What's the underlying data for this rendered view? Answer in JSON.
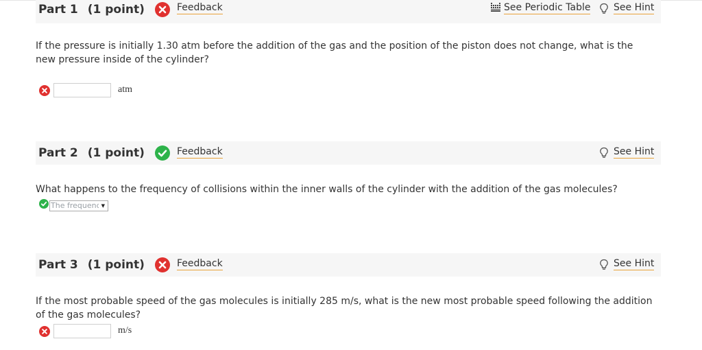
{
  "toolbar": {
    "periodic_table_label": "See Periodic Table",
    "periodic_table_icon": "periodic-table-icon"
  },
  "colors": {
    "correct": "#2db34a",
    "incorrect": "#e0312f",
    "link_underline": "#e8a33a",
    "header_bg": "#f6f6f6"
  },
  "parts": [
    {
      "title": "Part 1",
      "points": "(1 point)",
      "status": "incorrect",
      "feedback_label": "Feedback",
      "hint_label": "See Hint",
      "question": "If the pressure is initially 1.30 atm before the addition of the gas and the position of the piston does not change, what is the new pressure inside of the cylinder?",
      "answer": {
        "type": "input",
        "status": "incorrect",
        "value": "",
        "unit": "atm"
      }
    },
    {
      "title": "Part 2",
      "points": "(1 point)",
      "status": "correct",
      "feedback_label": "Feedback",
      "hint_label": "See Hint",
      "question": "What happens to the frequency of collisions within the inner walls of the cylinder with the addition of the gas molecules?",
      "answer": {
        "type": "select",
        "status": "correct",
        "selected": "The frequenc"
      }
    },
    {
      "title": "Part 3",
      "points": "(1 point)",
      "status": "incorrect",
      "feedback_label": "Feedback",
      "hint_label": "See Hint",
      "question": "If the most probable speed of the gas molecules is initially 285 m/s, what is the new most probable speed following the addition of the gas molecules?",
      "answer": {
        "type": "input",
        "status": "incorrect",
        "value": "",
        "unit": "m/s"
      }
    }
  ]
}
